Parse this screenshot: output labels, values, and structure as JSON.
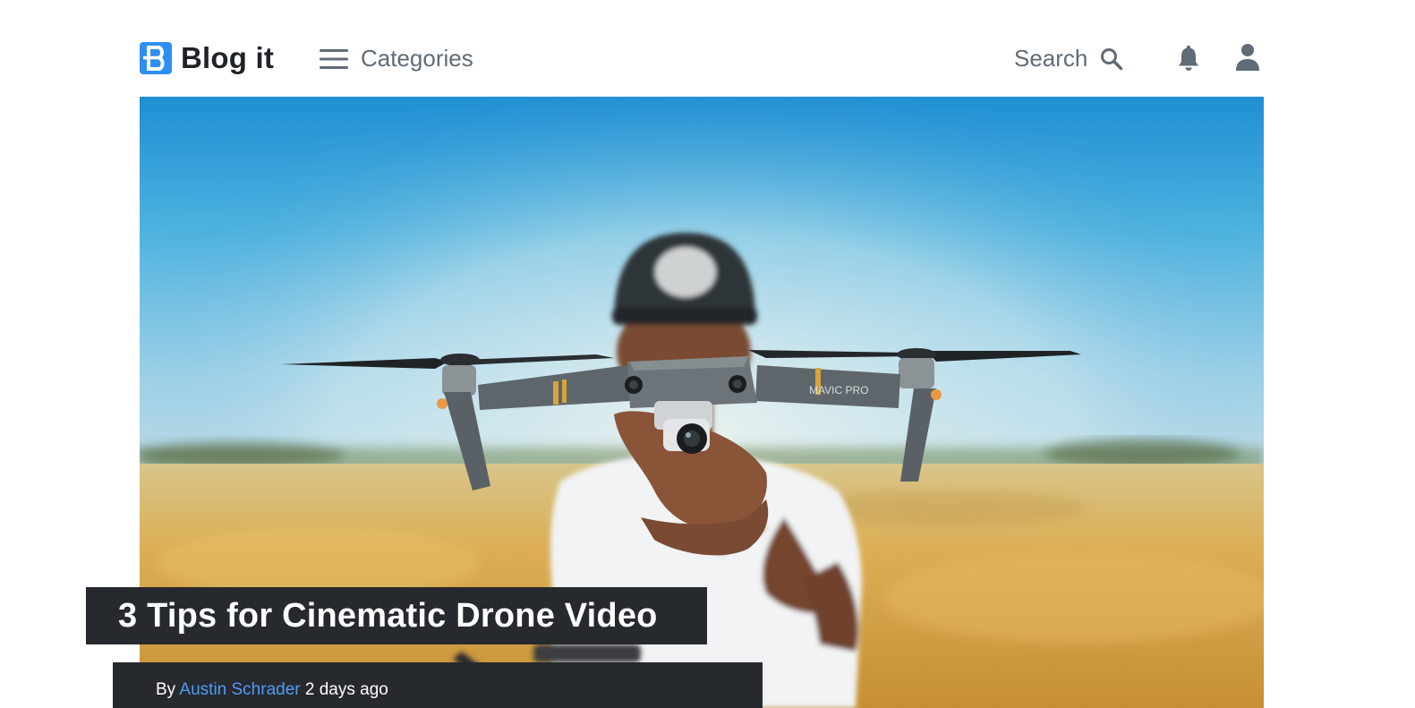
{
  "header": {
    "logo_letter": "B",
    "logo_text": "Blog it",
    "categories_label": "Categories",
    "search_label": "Search",
    "icons": {
      "logo": "logo-b-icon",
      "menu": "hamburger-icon",
      "search": "search-icon",
      "notifications": "bell-icon",
      "account": "user-icon"
    }
  },
  "post": {
    "title": "3 Tips for Cinematic Drone Video",
    "by_label": "By",
    "author": "Austin Schrader",
    "date": "2 days ago",
    "hero_image": "person holding a drone in a wheat field under a blue sky",
    "drone_marking": "MAVIC PRO"
  },
  "colors": {
    "brand": "#2f8ff0",
    "text_dark": "#1f2328",
    "text_muted": "#5f6b76",
    "card_bg": "#26292e",
    "link": "#4f9cf2"
  }
}
